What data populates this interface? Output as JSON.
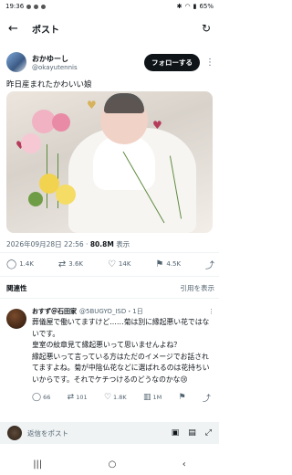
{
  "status_bar": {
    "time": "19:36",
    "battery": "65%"
  },
  "header": {
    "title": "ポスト"
  },
  "author": {
    "display_name": "おかゆーし",
    "handle": "@okayutennis",
    "follow_label": "フォローする"
  },
  "post": {
    "text": "昨日産まれたかわいい娘",
    "date": "2026年09月28日 22:56",
    "views_count": "80.8M",
    "views_label": "表示"
  },
  "actions": {
    "replies": "1.4K",
    "reposts": "3.6K",
    "likes": "14K",
    "bookmarks": "4.5K"
  },
  "relevance": {
    "left": "関連性",
    "right": "引用を表示"
  },
  "reply": {
    "name": "おすず＠石田家",
    "handle": "@5BUGYO_ISD・1日",
    "text": "葬儀屋で働いてますけど……菊は別に縁起悪い花ではないです。\n皇室の紋章見て縁起悪いって思いませんよね？\n縁起悪いって言っている方はただのイメージでお話されてますよね。菊が中陰仏花などに選ばれるのは花持ちいいからです。それでケチつけるのどうなのかな😢",
    "replies": "66",
    "reposts": "101",
    "likes": "1.8K",
    "views": "1M"
  },
  "compose": {
    "placeholder": "返信をポスト"
  },
  "icons": {
    "back": "back-arrow-icon",
    "refresh": "refresh-icon",
    "more": "more-icon",
    "reply": "reply-icon",
    "repost": "repost-icon",
    "like": "heart-icon",
    "bookmark": "bookmark-icon",
    "share": "share-icon"
  }
}
